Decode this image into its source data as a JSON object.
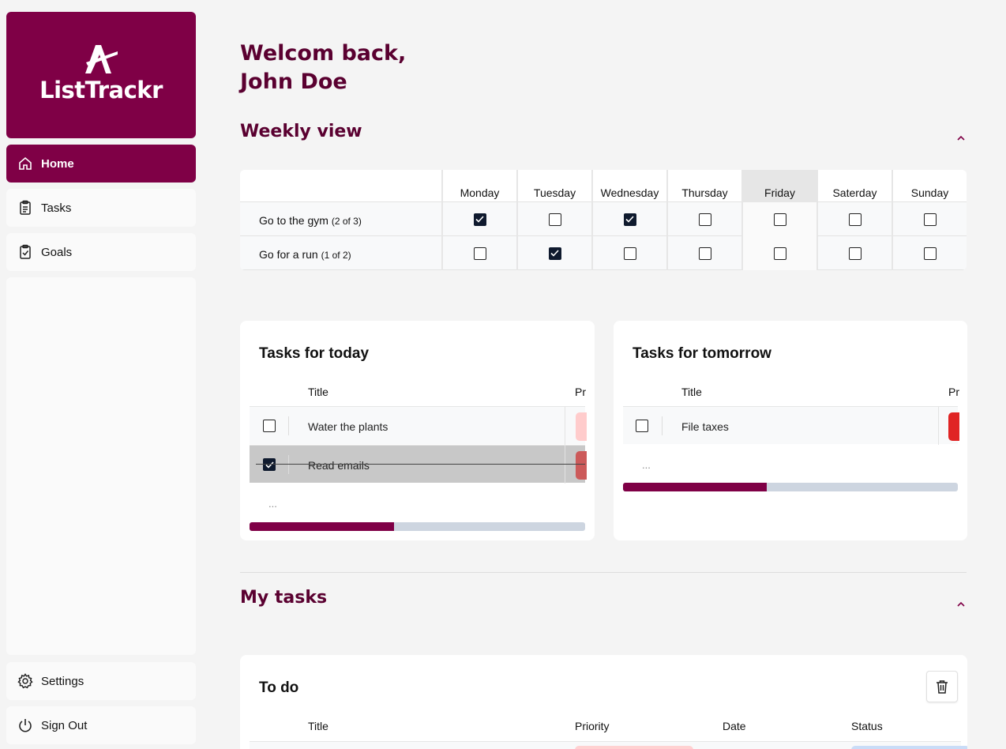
{
  "app": {
    "name": "ListTrackr"
  },
  "sidebar": {
    "items": [
      {
        "label": "Home",
        "icon": "home-icon",
        "active": true
      },
      {
        "label": "Tasks",
        "icon": "clipboard-icon"
      },
      {
        "label": "Goals",
        "icon": "clipboard-check-icon"
      }
    ],
    "bottom": [
      {
        "label": "Settings",
        "icon": "gear-icon"
      },
      {
        "label": "Sign Out",
        "icon": "power-icon"
      }
    ]
  },
  "welcome": {
    "line1": "Welcom back,",
    "line2": "John Doe"
  },
  "weekly": {
    "title": "Weekly view",
    "days": [
      "Monday",
      "Tuesday",
      "Wednesday",
      "Thursday",
      "Friday",
      "Saterday",
      "Sunday"
    ],
    "today_index": 4,
    "rows": [
      {
        "label": "Go to the gym",
        "count": "(2 of 3)",
        "checks": [
          true,
          false,
          true,
          false,
          false,
          false,
          false
        ]
      },
      {
        "label": "Go for a run",
        "count": "(1 of 2)",
        "checks": [
          false,
          true,
          false,
          false,
          false,
          false,
          false
        ]
      }
    ]
  },
  "today": {
    "title": "Tasks for today",
    "col_title": "Title",
    "col_priority": "Pr",
    "tasks": [
      {
        "title": "Water the plants",
        "done": false,
        "priority_color": "#ffcccc"
      },
      {
        "title": "Read emails",
        "done": true,
        "priority_color": "#cc5a5a"
      }
    ],
    "more": "...",
    "progress": 0.43
  },
  "tomorrow": {
    "title": "Tasks for tomorrow",
    "col_title": "Title",
    "col_priority": "Pr",
    "tasks": [
      {
        "title": "File taxes",
        "done": false,
        "priority_color": "#e02424"
      }
    ],
    "more": "...",
    "progress": 0.43
  },
  "my_tasks": {
    "title": "My tasks",
    "todo": {
      "title": "To do",
      "columns": [
        "Title",
        "Priority",
        "Date",
        "Status"
      ]
    }
  },
  "colors": {
    "brand": "#7f0046",
    "heading": "#5a0030"
  }
}
